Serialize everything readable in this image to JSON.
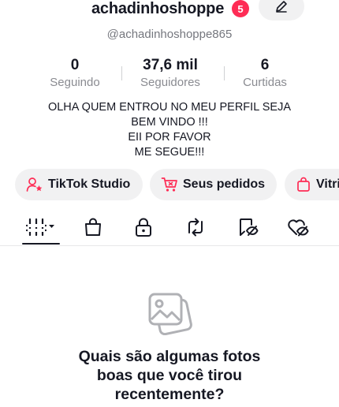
{
  "profile": {
    "username": "achadinhoshoppe",
    "notification_count": "5",
    "handle": "@achadinhoshoppe865",
    "edit_icon": "pencil-icon"
  },
  "stats": [
    {
      "value": "0",
      "label": "Seguindo"
    },
    {
      "value": "37,6 mil",
      "label": "Seguidores"
    },
    {
      "value": "6",
      "label": "Curtidas"
    }
  ],
  "bio": {
    "lines": [
      "OLHA QUEM ENTROU NO MEU PERFIL SEJA",
      "BEM VINDO !!!",
      "EII POR FAVOR",
      "ME SEGUE!!!"
    ]
  },
  "actions": [
    {
      "label": "TikTok Studio",
      "icon": "person-star-icon"
    },
    {
      "label": "Seus pedidos",
      "icon": "cart-icon"
    },
    {
      "label": "Vitri",
      "icon": "shopping-bag-icon"
    }
  ],
  "tabs": [
    {
      "icon": "grid-filter-icon",
      "active": true
    },
    {
      "icon": "shopping-bag-icon",
      "active": false
    },
    {
      "icon": "lock-icon",
      "active": false
    },
    {
      "icon": "repost-icon",
      "active": false
    },
    {
      "icon": "hidden-favorites-icon",
      "active": false
    },
    {
      "icon": "hidden-liked-icon",
      "active": false
    }
  ],
  "empty_state": {
    "icon": "photos-icon",
    "lines": [
      "Quais são algumas fotos",
      "boas que você tirou",
      "recentemente?"
    ]
  },
  "colors": {
    "accent": "#fe2c55",
    "text_primary": "#161823",
    "text_secondary": "#8a8b91",
    "pill_bg": "#f1f1f2"
  }
}
